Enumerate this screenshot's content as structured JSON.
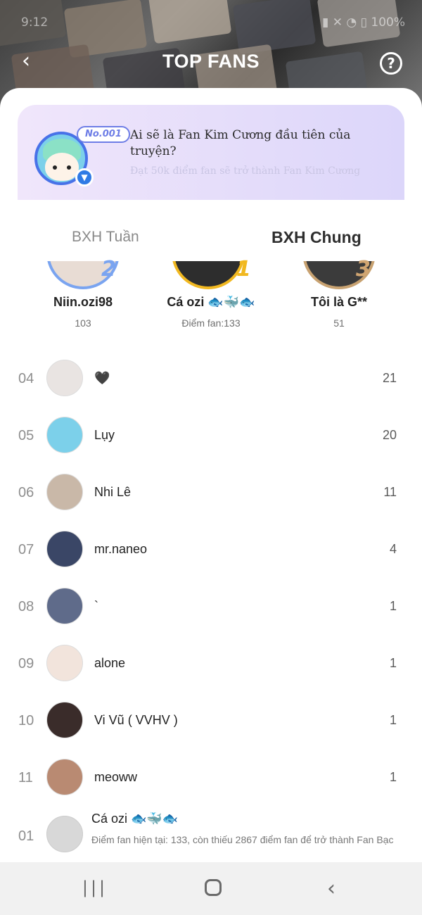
{
  "status": {
    "time": "9:12",
    "battery": "100%",
    "right_icons": "▮ ✕ ◔ ▯"
  },
  "header": {
    "title": "TOP FANS",
    "back_icon": "chevron-left",
    "help_icon": "question-circle",
    "help_text": "?"
  },
  "banner": {
    "badge": "No.001",
    "title": "Ai sẽ là Fan Kim Cương đầu tiên của truyện?",
    "subtitle": "Đạt 50k điểm fan sẽ trở thành Fan Kim Cương"
  },
  "tabs": [
    {
      "label": "BXH Tuần",
      "active": false
    },
    {
      "label": "BXH Chung",
      "active": true
    }
  ],
  "podium": [
    {
      "rank": "2",
      "name": "Niin.ozi98",
      "score": "103"
    },
    {
      "rank": "1",
      "name": "Cá ozi 🐟🐳🐟",
      "score": "Điểm fan:133"
    },
    {
      "rank": "3",
      "name": "Tôi là G**",
      "score": "51"
    }
  ],
  "rows": [
    {
      "rank": "04",
      "name": "🖤",
      "score": "21",
      "color": "#e9e4e2"
    },
    {
      "rank": "05",
      "name": "Lụy",
      "score": "20",
      "color": "#7cd0ea"
    },
    {
      "rank": "06",
      "name": "Nhi Lê",
      "score": "11",
      "color": "#c9b8a8"
    },
    {
      "rank": "07",
      "name": "mr.naneo",
      "score": "4",
      "color": "#3a4666"
    },
    {
      "rank": "08",
      "name": "`",
      "score": "1",
      "color": "#5f6b8a"
    },
    {
      "rank": "09",
      "name": "alone",
      "score": "1",
      "color": "#f2e4dc"
    },
    {
      "rank": "10",
      "name": "Vi Vũ ( VVHV )",
      "score": "1",
      "color": "#3a2c2a"
    },
    {
      "rank": "11",
      "name": "meoww",
      "score": "1",
      "color": "#b98a72"
    }
  ],
  "me": {
    "rank": "01",
    "name": "Cá ozi 🐟🐳🐟",
    "info": "Điểm fan hiện tại: 133, còn thiếu 2867 điểm fan để trở thành Fan Bạc"
  },
  "colors": {
    "gold": "#f1b820",
    "silver": "#7aa4f0",
    "bronze": "#c8a271",
    "banner_start": "#f0e6fb",
    "banner_end": "#dcd6fa"
  }
}
